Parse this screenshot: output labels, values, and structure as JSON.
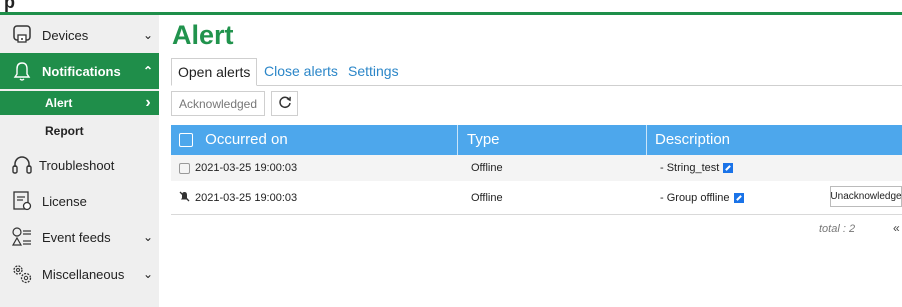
{
  "top": {
    "glyph": "p"
  },
  "sidebar": {
    "items": [
      {
        "label": "Devices",
        "icon": "devices-icon",
        "chevron": "⌄"
      },
      {
        "label": "Notifications",
        "icon": "bell-icon",
        "chevron": "⌃"
      },
      {
        "label": "Alert",
        "chevron": "›"
      },
      {
        "label": "Report"
      },
      {
        "label": "Troubleshoot",
        "icon": "headset-icon"
      },
      {
        "label": "License",
        "icon": "license-icon"
      },
      {
        "label": "Event feeds",
        "icon": "event-feeds-icon",
        "chevron": "⌄"
      },
      {
        "label": "Miscellaneous",
        "icon": "gears-icon",
        "chevron": "⌄"
      }
    ]
  },
  "main": {
    "title": "Alert",
    "tabs": [
      {
        "label": "Open alerts"
      },
      {
        "label": "Close alerts"
      },
      {
        "label": "Settings"
      }
    ],
    "toolbar": {
      "acknowledged_label": "Acknowledged",
      "refresh_icon": "refresh-icon"
    },
    "table": {
      "columns": [
        "Occurred on",
        "Type",
        "Description"
      ],
      "rows": [
        {
          "occurred_on": "2021-03-25 19:00:03",
          "type": "Offline",
          "description": "- String_test"
        },
        {
          "occurred_on": "2021-03-25 19:00:03",
          "type": "Offline",
          "description": "- Group offline",
          "action": "Unacknowledge"
        }
      ],
      "total": "total : 2",
      "pager_prev": "«"
    }
  },
  "colors": {
    "brand_green": "#21934d",
    "sidebar_active": "#1f8e4a",
    "table_header": "#4da7ec",
    "link": "#2b86c8"
  }
}
